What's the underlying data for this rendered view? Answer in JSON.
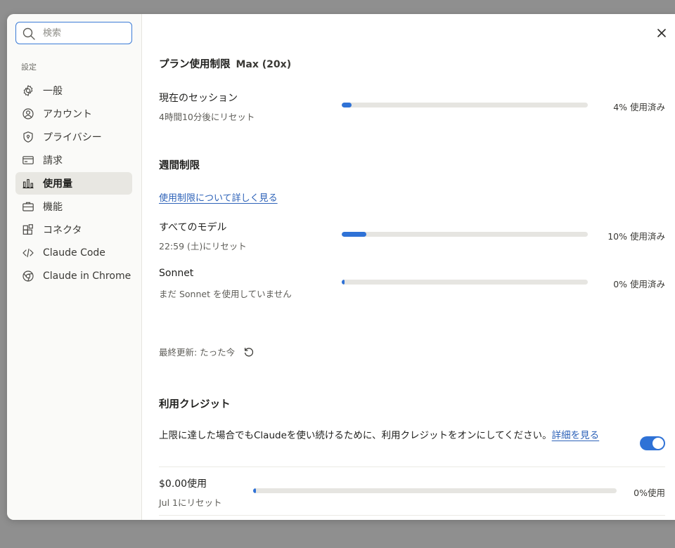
{
  "search": {
    "placeholder": "検索"
  },
  "sidebar": {
    "section_label": "設定",
    "items": [
      {
        "label": "一般",
        "icon": "gear-icon"
      },
      {
        "label": "アカウント",
        "icon": "user-circle-icon"
      },
      {
        "label": "プライバシー",
        "icon": "shield-icon"
      },
      {
        "label": "請求",
        "icon": "credit-card-icon"
      },
      {
        "label": "使用量",
        "icon": "bar-chart-icon",
        "active": true
      },
      {
        "label": "機能",
        "icon": "briefcase-icon"
      },
      {
        "label": "コネクタ",
        "icon": "blocks-icon"
      },
      {
        "label": "Claude Code",
        "icon": "code-icon"
      },
      {
        "label": "Claude in Chrome",
        "icon": "globe-icon"
      }
    ]
  },
  "plan": {
    "title": "プラン使用制限",
    "badge": "Max (20x)",
    "session": {
      "label": "現在のセッション",
      "reset": "4時間10分後にリセット",
      "percent": 4,
      "percent_label": "4% 使用済み"
    }
  },
  "weekly": {
    "title": "週間制限",
    "link": "使用制限について詳しく見る",
    "all_models": {
      "label": "すべてのモデル",
      "reset": "22:59 (土)にリセット",
      "percent": 10,
      "percent_label": "10% 使用済み"
    },
    "sonnet": {
      "label": "Sonnet",
      "reset": "まだ Sonnet を使用していません",
      "percent": 0,
      "percent_label": "0% 使用済み"
    }
  },
  "updated": {
    "label": "最終更新: たった今"
  },
  "credits": {
    "title": "利用クレジット",
    "description": "上限に達した場合でもClaudeを使い続けるために、利用クレジットをオンにしてください。",
    "details_link": "詳細を見る",
    "toggle_on": true,
    "usage": {
      "label": "$0.00使用",
      "reset": "Jul 1にリセット",
      "percent": 0,
      "percent_label": "0%使用"
    }
  },
  "colors": {
    "accent": "#2f72d6",
    "link": "#2d62b8",
    "active_nav": "#e8e7e2",
    "overlay": "#8f8f8f"
  }
}
